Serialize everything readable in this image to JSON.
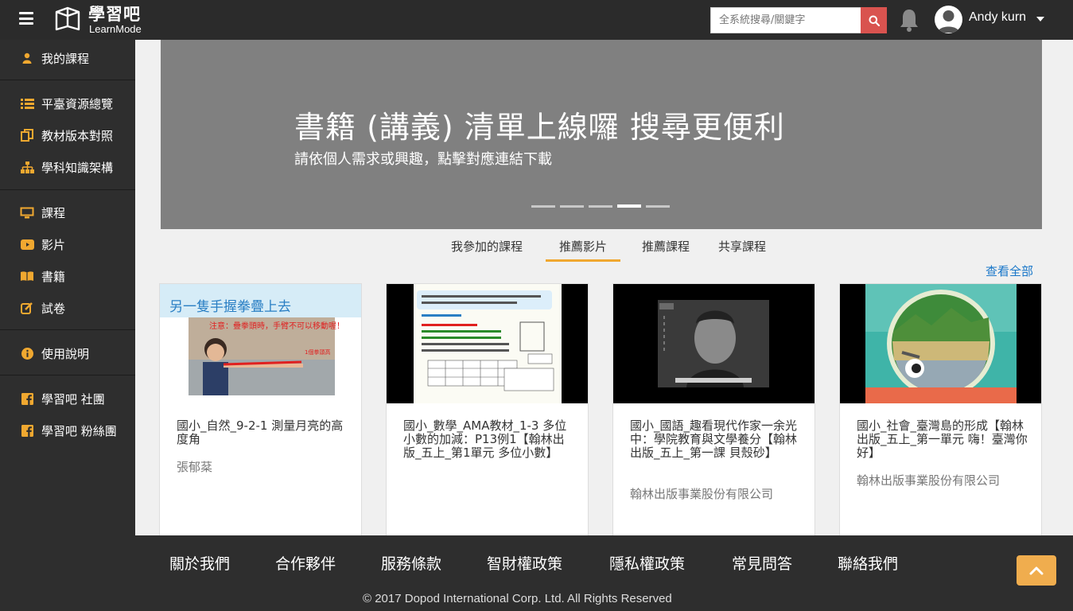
{
  "header": {
    "logo_cn": "學習吧",
    "logo_en": "LearnMode",
    "search_placeholder": "全系統搜尋/關鍵字",
    "username": "Andy kurn"
  },
  "sidebar": {
    "items": [
      {
        "label": "我的課程",
        "icon": "user-icon"
      },
      {
        "label": "平臺資源總覽",
        "icon": "list-icon"
      },
      {
        "label": "教材版本對照",
        "icon": "copy-icon"
      },
      {
        "label": "學科知識架構",
        "icon": "sitemap-icon"
      },
      {
        "label": "課程",
        "icon": "monitor-icon"
      },
      {
        "label": "影片",
        "icon": "youtube-icon"
      },
      {
        "label": "書籍",
        "icon": "book-icon"
      },
      {
        "label": "試卷",
        "icon": "edit-icon"
      },
      {
        "label": "使用說明",
        "icon": "info-icon"
      },
      {
        "label": "學習吧 社團",
        "icon": "facebook-icon"
      },
      {
        "label": "學習吧 粉絲團",
        "icon": "facebook-icon"
      }
    ]
  },
  "banner": {
    "title": "書籍 (講義) 清單上線囉 搜尋更便利",
    "subtitle": "請依個人需求或興趣，點擊對應連結下載",
    "slide_count": 5,
    "active_slide": 4
  },
  "tabs": [
    {
      "label": "我參加的課程"
    },
    {
      "label": "推薦影片",
      "active": true
    },
    {
      "label": "推薦課程"
    },
    {
      "label": "共享課程"
    }
  ],
  "view_all": "查看全部",
  "cards": [
    {
      "title": "國小_自然_9-2-1 測量月亮的高度角",
      "author": "張郁棻",
      "thumb_heading": "另一隻手握拳疊上去",
      "thumb_note": "注意：疊拳頭時，手臂不可以移動喔！",
      "thumb_label": "1個拳頭高"
    },
    {
      "title": "國小_數學_AMA教材_1-3 多位小數的加減：P13例1【翰林出版_五上_第1單元 多位小數】",
      "author": ""
    },
    {
      "title": "國小_國語_趣看現代作家一余光中：學院教育與文學養分【翰林出版_五上_第一課 貝殼砂】",
      "author": "翰林出版事業股份有限公司"
    },
    {
      "title": "國小_社會_臺灣島的形成【翰林出版_五上_第一單元 嗨！臺灣你好】",
      "author": "翰林出版事業股份有限公司"
    }
  ],
  "footer": {
    "links": [
      "關於我們",
      "合作夥伴",
      "服務條款",
      "智財權政策",
      "隱私權政策",
      "常見問答",
      "聯絡我們"
    ],
    "copyright": "© 2017 Dopod International Corp. Ltd. All Rights Reserved"
  },
  "colors": {
    "topbar": "#2b2b2b",
    "sidebar": "#2e2e2e",
    "accent": "#f0a830",
    "search_button": "#d9534f",
    "link": "#1a77c9"
  }
}
